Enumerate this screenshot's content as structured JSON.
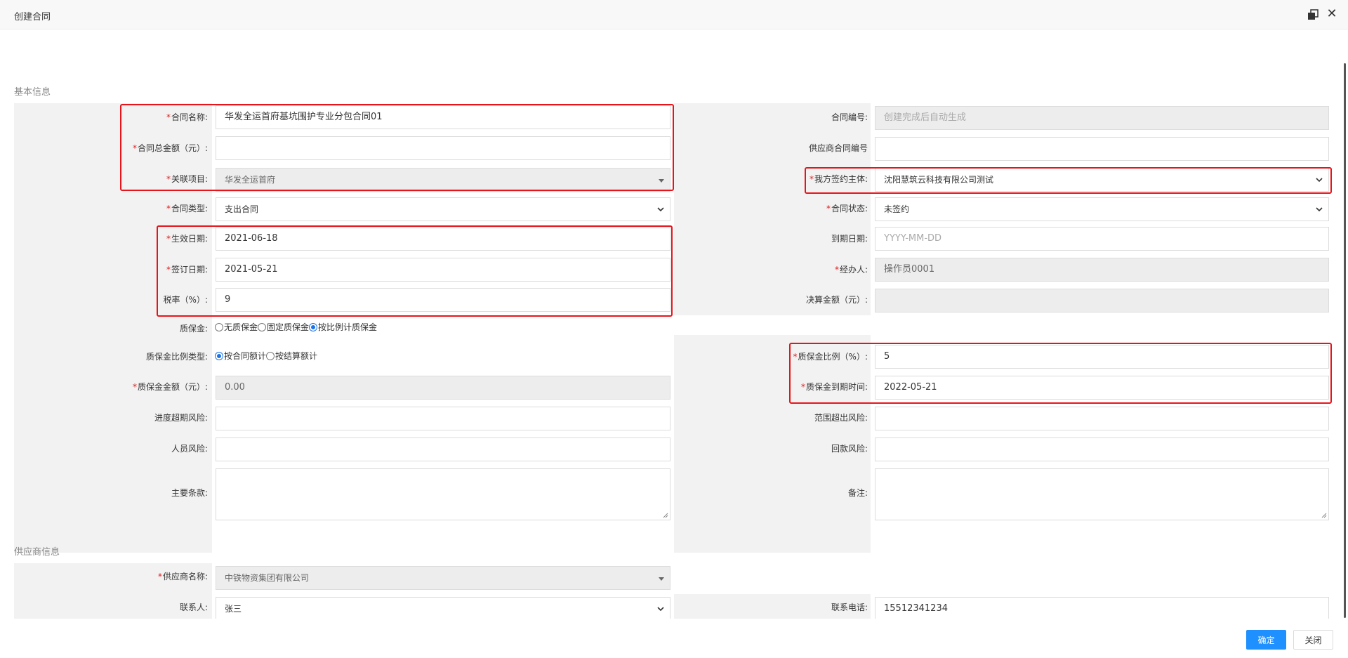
{
  "window": {
    "title": "创建合同",
    "maximize_icon": "window-restore-icon",
    "close_icon": "close-icon",
    "close_glyph": "✕"
  },
  "sections": {
    "basic": "基本信息",
    "supplier": "供应商信息"
  },
  "colors": {
    "accent": "#1e90ff",
    "required": "#e02020",
    "highlight_box": "#e8141b",
    "label_bg": "#f2f2f2",
    "disabled_bg": "#ededed"
  },
  "basic": {
    "contract_name": {
      "label": "合同名称:",
      "value": "华发全运首府基坑围护专业分包合同01"
    },
    "contract_no": {
      "label": "合同编号:",
      "placeholder": "创建完成后自动生成"
    },
    "total_amount": {
      "label": "合同总金额（元）:",
      "value": ""
    },
    "supplier_contract_no": {
      "label": "供应商合同编号",
      "value": ""
    },
    "project": {
      "label": "关联项目:",
      "value": "华发全运首府"
    },
    "signing_entity": {
      "label": "我方签约主体:",
      "value": "沈阳慧筑云科技有限公司测试"
    },
    "contract_type": {
      "label": "合同类型:",
      "value": "支出合同"
    },
    "contract_status": {
      "label": "合同状态:",
      "value": "未签约"
    },
    "effective_date": {
      "label": "生效日期:",
      "value": "2021-06-18"
    },
    "expiry_date": {
      "label": "到期日期:",
      "placeholder": "YYYY-MM-DD"
    },
    "sign_date": {
      "label": "签订日期:",
      "value": "2021-05-21"
    },
    "handler": {
      "label": "经办人:",
      "value": "操作员0001"
    },
    "tax_rate": {
      "label": "税率（%）:",
      "value": "9"
    },
    "settlement_amount": {
      "label": "决算金额（元）:",
      "value": ""
    },
    "retention": {
      "label": "质保金:",
      "options": [
        "无质保金",
        "固定质保金",
        "按比例计质保金"
      ],
      "selected": 2
    },
    "retention_ratio_type": {
      "label": "质保金比例类型:",
      "options": [
        "按合同额计",
        "按结算额计"
      ],
      "selected": 0
    },
    "retention_ratio": {
      "label": "质保金比例（%）:",
      "value": "5"
    },
    "retention_amount": {
      "label": "质保金金额（元）:",
      "value": "0.00"
    },
    "retention_due": {
      "label": "质保金到期时间:",
      "value": "2022-05-21"
    },
    "schedule_risk": {
      "label": "进度超期风险:",
      "value": ""
    },
    "scope_risk": {
      "label": "范围超出风险:",
      "value": ""
    },
    "personnel_risk": {
      "label": "人员风险:",
      "value": ""
    },
    "payment_risk": {
      "label": "回款风险:",
      "value": ""
    },
    "main_terms": {
      "label": "主要条款:",
      "value": ""
    },
    "remarks": {
      "label": "备注:",
      "value": ""
    }
  },
  "supplier": {
    "name": {
      "label": "供应商名称:",
      "value": "中铁物资集团有限公司"
    },
    "contact": {
      "label": "联系人:",
      "value": "张三"
    },
    "phone": {
      "label": "联系电话:",
      "value": "15512341234"
    }
  },
  "footer": {
    "confirm": "确定",
    "close": "关闭"
  }
}
